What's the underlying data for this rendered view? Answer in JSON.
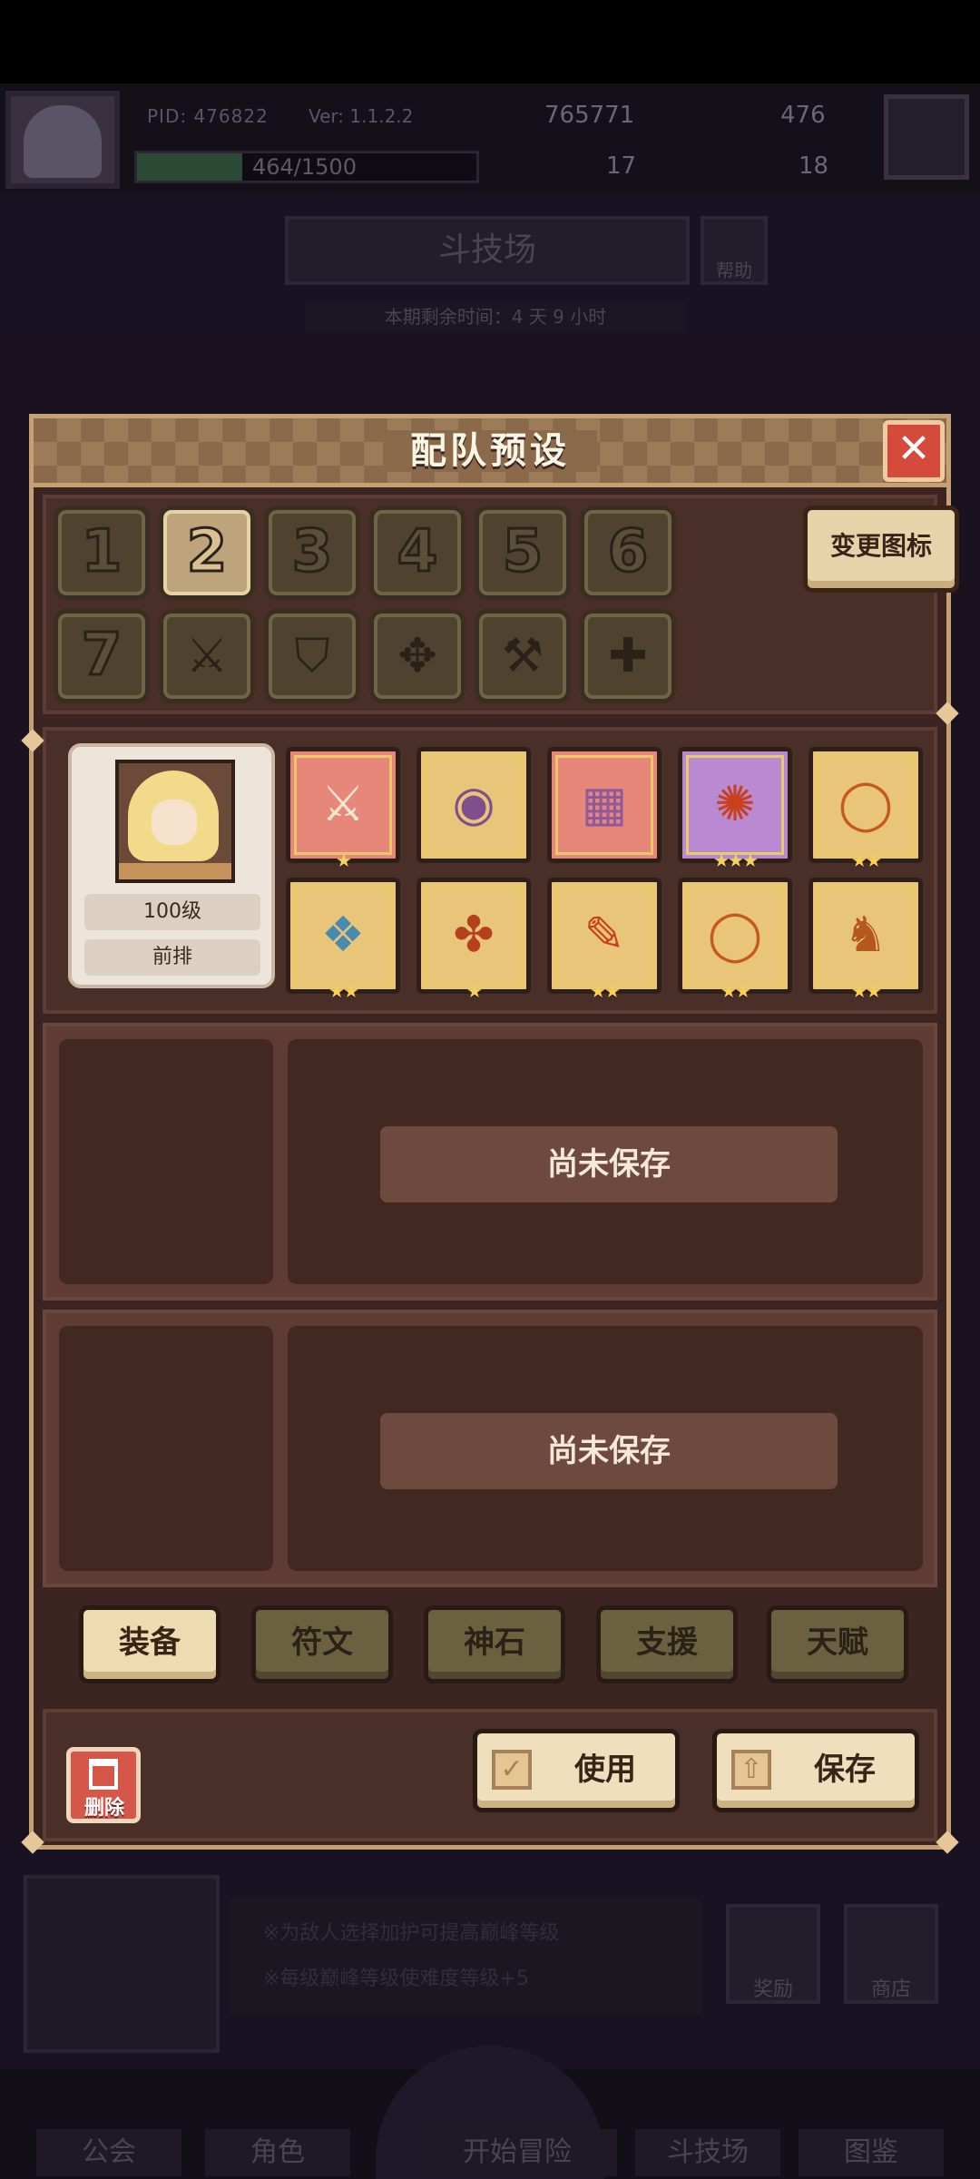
{
  "background": {
    "pid": "PID: 476822",
    "version": "Ver: 1.1.2.2",
    "gold": "765771",
    "gems": "476",
    "xp": "464/1500",
    "clover": "17",
    "keys": "18",
    "arena_title": "斗技场",
    "help_label": "帮助",
    "season_text": "本期剩余时间：4 天 9 小时",
    "tips": [
      "※为敌人选择加护可提高巅峰等级",
      "※每级巅峰等级使难度等级+5"
    ],
    "reward_label": "奖励",
    "shop_label": "商店",
    "nav": [
      "公会",
      "角色",
      "开始冒险",
      "斗技场",
      "图鉴"
    ]
  },
  "modal": {
    "title": "配队预设",
    "close_symbol": "✕",
    "change_icon_label": "变更图标",
    "preset_numbers": [
      "1",
      "2",
      "3",
      "4",
      "5",
      "6",
      "7"
    ],
    "active_preset": "2",
    "icon_presets": [
      "sword-icon",
      "shield-icon",
      "crossbow-icon",
      "wrench-icon",
      "cross-icon"
    ],
    "hero": {
      "level": "100级",
      "position": "前排"
    },
    "equipment": [
      {
        "name": "crossed-swords-icon",
        "stars": "★",
        "bg": "red"
      },
      {
        "name": "round-shield-icon",
        "stars": "",
        "bg": "gold"
      },
      {
        "name": "armor-vest-icon",
        "stars": "",
        "bg": "red"
      },
      {
        "name": "sun-medallion-icon",
        "stars": "★★★",
        "bg": "purple"
      },
      {
        "name": "ring-icon",
        "stars": "★★",
        "bg": "gold"
      },
      {
        "name": "crystal-crest-icon",
        "stars": "★★",
        "bg": "gold"
      },
      {
        "name": "winged-amulet-icon",
        "stars": "★",
        "bg": "gold"
      },
      {
        "name": "scroll-icon",
        "stars": "★★",
        "bg": "gold"
      },
      {
        "name": "ring-icon",
        "stars": "★★",
        "bg": "gold"
      },
      {
        "name": "boots-icon",
        "stars": "★★",
        "bg": "gold"
      }
    ],
    "slots": [
      {
        "status": "尚未保存"
      },
      {
        "status": "尚未保存"
      }
    ],
    "tabs": [
      "装备",
      "符文",
      "神石",
      "支援",
      "天赋"
    ],
    "active_tab": "装备",
    "delete_label": "删除",
    "use_label": "使用",
    "save_label": "保存"
  }
}
